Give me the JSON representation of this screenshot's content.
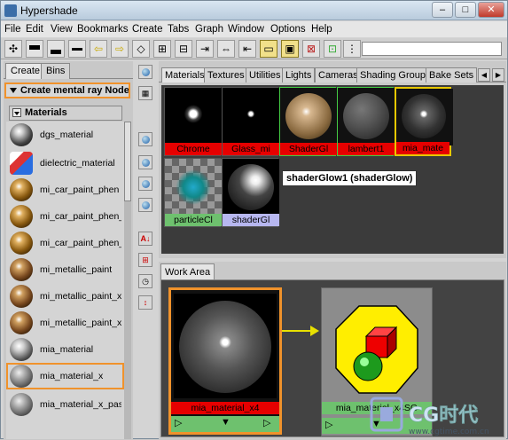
{
  "window": {
    "title": "Hypershade",
    "minimize": "–",
    "maximize": "□",
    "close": "✕"
  },
  "menu": [
    "File",
    "Edit",
    "View",
    "Bookmarks",
    "Create",
    "Tabs",
    "Graph",
    "Window",
    "Options",
    "Help"
  ],
  "left_tabs": [
    "Create",
    "Bins"
  ],
  "create_dropdown": "Create mental ray Nodes",
  "materials_header": "Materials",
  "materials": [
    {
      "label": "dgs_material"
    },
    {
      "label": "dielectric_material"
    },
    {
      "label": "mi_car_paint_phen"
    },
    {
      "label": "mi_car_paint_phen_"
    },
    {
      "label": "mi_car_paint_phen_"
    },
    {
      "label": "mi_metallic_paint"
    },
    {
      "label": "mi_metallic_paint_x"
    },
    {
      "label": "mi_metallic_paint_x_"
    },
    {
      "label": "mia_material"
    },
    {
      "label": "mia_material_x"
    },
    {
      "label": "mia_material_x_pass"
    }
  ],
  "top_tabs": [
    "Materials",
    "Textures",
    "Utilities",
    "Lights",
    "Cameras",
    "Shading Groups",
    "Bake Sets"
  ],
  "swatches": [
    {
      "label": "Chrome"
    },
    {
      "label": "Glass_mi"
    },
    {
      "label": "ShaderGl"
    },
    {
      "label": "lambert1"
    },
    {
      "label": "mia_mate"
    },
    {
      "label": "particleCl"
    },
    {
      "label": "shaderGl"
    }
  ],
  "tooltip": "shaderGlow1 (shaderGlow)",
  "work_area_tab": "Work Area",
  "work_nodes": [
    {
      "label": "mia_material_x4"
    },
    {
      "label": "mia_material_x4SG"
    }
  ],
  "watermark": {
    "brand": "CG时代",
    "url": "www.cgtime.com.cn"
  }
}
